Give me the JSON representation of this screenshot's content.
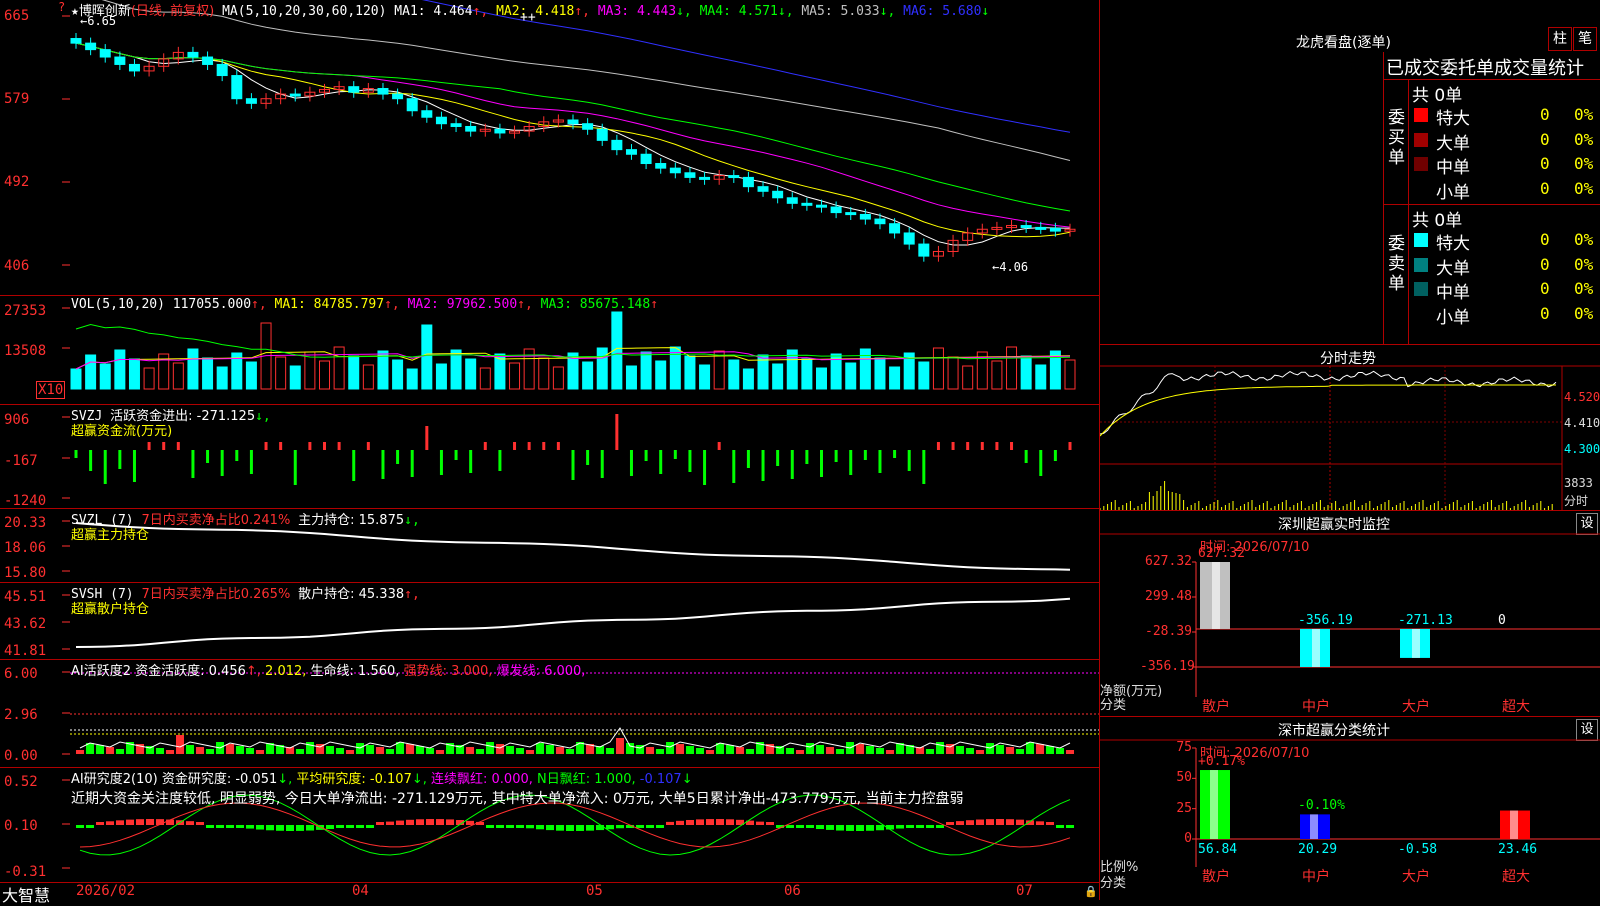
{
  "main": {
    "star": "★",
    "stock_name": "博晖创新",
    "period_tag": "(日线, 前复权)",
    "ma_header": "MA(5,10,20,30,60,120)",
    "ma_values": [
      {
        "label": "MA1: 4.464",
        "arrow": "↑",
        "color": "#ffffff"
      },
      {
        "label": "MA2: 4.418",
        "arrow": "↑",
        "color": "#ffff00"
      },
      {
        "label": "MA3: 4.443",
        "arrow": "↓",
        "color": "#ff00ff"
      },
      {
        "label": "MA4: 4.571",
        "arrow": "↓",
        "color": "#00ff00"
      },
      {
        "label": "MA5: 5.033",
        "arrow": "↓",
        "color": "#c0c0c0"
      },
      {
        "label": "MA6: 5.680",
        "arrow": "↓",
        "color": "#3030ff"
      }
    ],
    "high_marker": "←6.65",
    "low_marker": "←4.06",
    "y_ticks": [
      "665",
      "579",
      "492",
      "406"
    ],
    "plus_marks": "++"
  },
  "vol": {
    "header": "VOL(5,10,20)",
    "value": "117055.000",
    "ma1": "MA1: 84785.797",
    "ma2": "MA2: 97962.500",
    "ma3": "MA3: 85675.148",
    "y_ticks": [
      "27353",
      "13508"
    ],
    "unit": "X10"
  },
  "svzj": {
    "header": "SVZJ",
    "title": "活跃资金进出: -271.125",
    "subtitle": "超赢资金流(万元)",
    "y_ticks": [
      "906",
      "-167",
      "-1240"
    ]
  },
  "svzl": {
    "header": "SVZL (7)",
    "ratio": "7日内买卖净占比0.241%",
    "holding": "主力持仓: 15.875",
    "subtitle": "超赢主力持仓",
    "y_ticks": [
      "20.33",
      "18.06",
      "15.80"
    ]
  },
  "svsh": {
    "header": "SVSH (7)",
    "ratio": "7日内买卖净占比0.265%",
    "holding": "散户持仓: 45.338",
    "subtitle": "超赢散户持仓",
    "y_ticks": [
      "45.51",
      "43.62",
      "41.81"
    ]
  },
  "ai1": {
    "header": "AI活跃度2",
    "activity": "资金活跃度: 0.456",
    "v2": "2.012,",
    "life": "生命线: 1.560,",
    "strong": "强势线: 3.000,",
    "burst": "爆发线: 6.000,",
    "y_ticks": [
      "6.00",
      "2.96",
      "0.00"
    ]
  },
  "ai2": {
    "header": "AI研究度2(10)",
    "research": "资金研究度: -0.051",
    "avg": "平均研究度: -0.107",
    "streak": "连续飘红: 0.000,",
    "nday": "N日飘红: 1.000,",
    "last": "-0.107",
    "comment": "近期大资金关注度较低, 明显弱势, 今日大单净流出: -271.129万元, 其中特大单净流入: 0万元, 大单5日累计净出-473.779万元, 当前主力控盘弱",
    "y_ticks": [
      "0.52",
      "0.10",
      "-0.31"
    ]
  },
  "xaxis": {
    "brand": "大智慧",
    "labels": [
      "2026/02",
      "04",
      "05",
      "06",
      "07"
    ]
  },
  "dragon": {
    "title": "龙虎看盘(逐单)",
    "btn_bar": "柱",
    "btn_pen": "笔",
    "subtitle": "已成交委托单成交量统计",
    "buy_label": "委买单",
    "sell_label": "委卖单",
    "buy_total": "共 0单",
    "sell_total": "共 0单",
    "buy_rows": [
      {
        "name": "特大",
        "count": "0",
        "pct": "0%",
        "color": "#ff0000"
      },
      {
        "name": "大单",
        "count": "0",
        "pct": "0%",
        "color": "#a00000"
      },
      {
        "name": "中单",
        "count": "0",
        "pct": "0%",
        "color": "#700000"
      },
      {
        "name": "小单",
        "count": "0",
        "pct": "0%",
        "color": ""
      }
    ],
    "sell_rows": [
      {
        "name": "特大",
        "count": "0",
        "pct": "0%",
        "color": "#00ffff"
      },
      {
        "name": "大单",
        "count": "0",
        "pct": "0%",
        "color": "#008080"
      },
      {
        "name": "中单",
        "count": "0",
        "pct": "0%",
        "color": "#006060"
      },
      {
        "name": "小单",
        "count": "0",
        "pct": "0%",
        "color": ""
      }
    ]
  },
  "intraday": {
    "title": "分时走势",
    "price_ticks": [
      "4.520",
      "4.410",
      "4.300"
    ],
    "vol_tick": "3833",
    "vol_label": "分时"
  },
  "monitor": {
    "title": "深圳超赢实时监控",
    "settings": "设",
    "time": "时间: 2026/07/10",
    "y_ticks": [
      "627.32",
      "299.48",
      "-28.39",
      "-356.19"
    ],
    "axis_name": "净额(万元)",
    "axis_sub": "分类",
    "bars": [
      {
        "cat": "散户",
        "value": 627.32,
        "label": "627.32",
        "color": "#c0c0c0",
        "label_color": "#ff3030"
      },
      {
        "cat": "中户",
        "value": -356.19,
        "label": "-356.19",
        "color": "#00ffff",
        "label_color": "#00ffff"
      },
      {
        "cat": "大户",
        "value": -271.13,
        "label": "-271.13",
        "color": "#00ffff",
        "label_color": "#00ffff"
      },
      {
        "cat": "超大",
        "value": 0,
        "label": "0",
        "color": "#ff0000",
        "label_color": "#ffffff"
      }
    ]
  },
  "classify": {
    "title": "深市超赢分类统计",
    "settings": "设",
    "time": "时间: 2026/07/10",
    "y_ticks": [
      "75",
      "50",
      "25",
      "0"
    ],
    "axis_name": "比例%",
    "axis_sub": "分类",
    "bars": [
      {
        "cat": "散户",
        "value": 56.84,
        "label": "56.84",
        "delta": "+0.17%",
        "color": "#00ff00",
        "delta_color": "#ff3030"
      },
      {
        "cat": "中户",
        "value": 20.29,
        "label": "20.29",
        "delta": "-0.10%",
        "color": "#0000ff",
        "delta_color": "#00ff00"
      },
      {
        "cat": "大户",
        "value": -0.58,
        "label": "-0.58",
        "delta": "",
        "color": "#00ffff",
        "delta_color": "#00ff00"
      },
      {
        "cat": "超大",
        "value": 23.46,
        "label": "23.46",
        "delta": "",
        "color": "#ff0000",
        "delta_color": "#ff3030"
      }
    ]
  },
  "chart_data": {
    "type": "candlestick",
    "x_labels": [
      "2026/02",
      "04",
      "05",
      "06",
      "07"
    ],
    "ylim": [
      406,
      665
    ],
    "y_ticks": [
      665,
      579,
      492,
      406
    ],
    "high": 6.65,
    "low": 4.06,
    "moving_averages": {
      "MA1": 4.464,
      "MA2": 4.418,
      "MA3": 4.443,
      "MA4": 4.571,
      "MA5": 5.033,
      "MA6": 5.68
    },
    "close_series": [
      6.45,
      6.38,
      6.3,
      6.22,
      6.15,
      6.2,
      6.28,
      6.35,
      6.3,
      6.22,
      6.1,
      5.85,
      5.8,
      5.85,
      5.9,
      5.88,
      5.92,
      5.95,
      5.98,
      5.92,
      5.96,
      5.9,
      5.85,
      5.72,
      5.65,
      5.58,
      5.55,
      5.5,
      5.52,
      5.48,
      5.5,
      5.55,
      5.6,
      5.62,
      5.58,
      5.52,
      5.4,
      5.3,
      5.25,
      5.15,
      5.1,
      5.05,
      5.0,
      4.98,
      5.02,
      5.0,
      4.9,
      4.85,
      4.78,
      4.72,
      4.7,
      4.68,
      4.62,
      4.6,
      4.55,
      4.5,
      4.4,
      4.28,
      4.15,
      4.2,
      4.32,
      4.4,
      4.44,
      4.46,
      4.48,
      4.46,
      4.45,
      4.42,
      4.44
    ]
  }
}
